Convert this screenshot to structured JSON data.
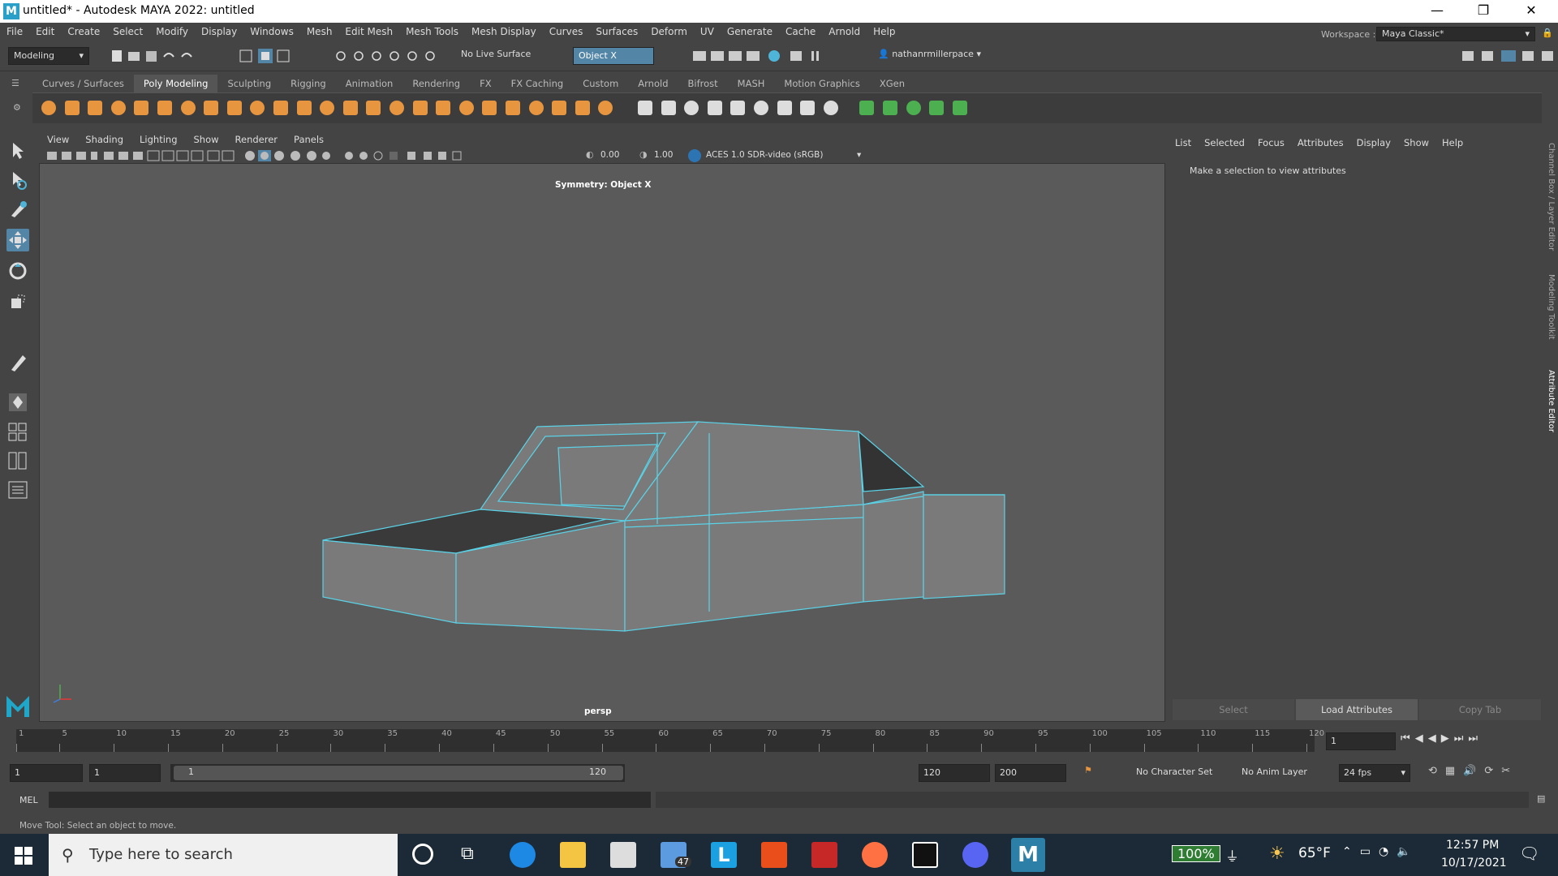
{
  "window": {
    "title": "untitled* - Autodesk MAYA 2022: untitled",
    "logo": "M"
  },
  "menubar": [
    "File",
    "Edit",
    "Create",
    "Select",
    "Modify",
    "Display",
    "Windows",
    "Mesh",
    "Edit Mesh",
    "Mesh Tools",
    "Mesh Display",
    "Curves",
    "Surfaces",
    "Deform",
    "UV",
    "Generate",
    "Cache",
    "Arnold",
    "Help"
  ],
  "status": {
    "mode": "Modeling",
    "live_surface": "No Live Surface",
    "symmetry": "Object X",
    "user": "nathanrmillerpace",
    "workspace_label": "Workspace :",
    "workspace": "Maya Classic*"
  },
  "shelf_tabs": [
    "Curves / Surfaces",
    "Poly Modeling",
    "Sculpting",
    "Rigging",
    "Animation",
    "Rendering",
    "FX",
    "FX Caching",
    "Custom",
    "Arnold",
    "Bifrost",
    "MASH",
    "Motion Graphics",
    "XGen"
  ],
  "shelf_active": "Poly Modeling",
  "viewport": {
    "menu": [
      "View",
      "Shading",
      "Lighting",
      "Show",
      "Renderer",
      "Panels"
    ],
    "exposure": "0.00",
    "gamma": "1.00",
    "color_space": "ACES 1.0 SDR-video (sRGB)",
    "hud_top": "Symmetry: Object X",
    "camera": "persp"
  },
  "attribute_editor": {
    "menu": [
      "List",
      "Selected",
      "Focus",
      "Attributes",
      "Display",
      "Show",
      "Help"
    ],
    "message": "Make a selection to view attributes",
    "buttons": [
      "Select",
      "Load Attributes",
      "Copy Tab"
    ],
    "side_tabs": [
      "Channel Box / Layer Editor",
      "Modeling Toolkit",
      "Attribute Editor"
    ]
  },
  "timeline": {
    "ticks": [
      "1",
      "5",
      "10",
      "15",
      "20",
      "25",
      "30",
      "35",
      "40",
      "45",
      "50",
      "55",
      "60",
      "65",
      "70",
      "75",
      "80",
      "85",
      "90",
      "95",
      "100",
      "105",
      "110",
      "115",
      "120"
    ],
    "current": "1"
  },
  "range": {
    "start": "1",
    "start2": "1",
    "slider_start": "1",
    "slider_end": "120",
    "end": "120",
    "end2": "200",
    "char_set": "No Character Set",
    "anim_layer": "No Anim Layer",
    "fps": "24 fps"
  },
  "cmd": {
    "lang": "MEL"
  },
  "helpline": "Move Tool: Select an object to move.",
  "taskbar": {
    "search": "Type here to search",
    "mail_badge": "47",
    "battery": "100%",
    "temp": "65°F",
    "time": "12:57 PM",
    "date": "10/17/2021"
  },
  "colors": {
    "accent": "#5285a6",
    "shelf_orange": "#e8953f",
    "mesh_wire": "#5ad3e8"
  }
}
